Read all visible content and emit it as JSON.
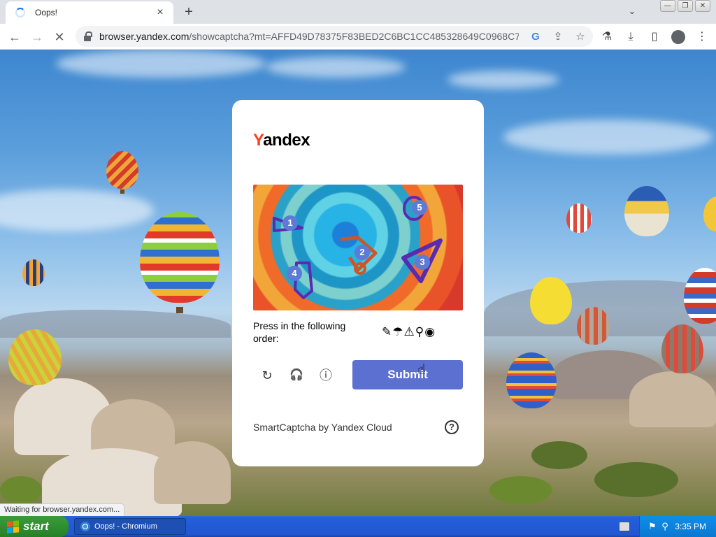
{
  "browser": {
    "tab_title": "Oops!",
    "tab_close": "×",
    "new_tab": "+",
    "tab_search": "⌄",
    "window_buttons": [
      "—",
      "❐",
      "✕"
    ],
    "url_host": "browser.yandex.com",
    "url_path": "/showcaptcha?mt=AFFD49D78375F83BED2C6BC1CC485328649C0968C77...",
    "back": "←",
    "forward": "→",
    "stop": "✕",
    "omnibox_icons": {
      "google": "G",
      "share": "⇪",
      "bookmark": "☆"
    },
    "toolbar_icons": {
      "extensions": "⚗",
      "download": "⤓",
      "sidepanel": "▯",
      "menu": "⋮"
    }
  },
  "captcha": {
    "logo_first": "Y",
    "logo_rest": "andex",
    "marks": [
      "1",
      "2",
      "3",
      "4",
      "5"
    ],
    "instruction": "Press in the following order:",
    "order_icons": [
      "✎",
      "☂",
      "⚠",
      "⚲",
      "◉"
    ],
    "actions": {
      "refresh": "↻",
      "audio": "🎧",
      "info": "ⓘ"
    },
    "submit_label": "Submit",
    "cursor": "☝",
    "brand": "SmartCaptcha by Yandex Cloud",
    "help": "?"
  },
  "status_bar": "Waiting for browser.yandex.com...",
  "taskbar": {
    "start_label": "start",
    "task_item": "Oops! - Chromium",
    "clock": "3:35 PM"
  },
  "colors": {
    "submit": "#5b70d0",
    "yandex_red": "#fc3f1d",
    "mark": "#5b7bd6",
    "taskbar": "#245edb",
    "start": "#2f8f2f"
  }
}
